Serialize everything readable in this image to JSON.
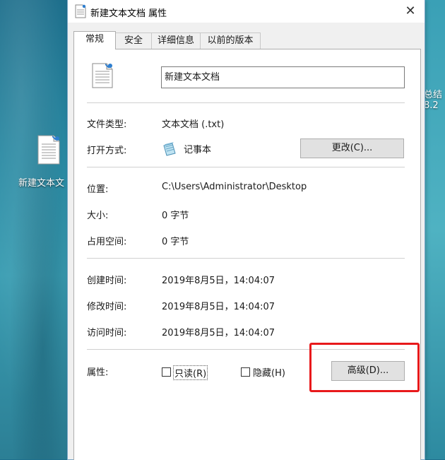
{
  "desktop": {
    "icon_label": "新建文本文",
    "edge_text_1": "总结",
    "edge_text_2": "8.2"
  },
  "window": {
    "title": "新建文本文档 属性",
    "close_glyph": "✕"
  },
  "tabs": [
    {
      "label": "常规",
      "active": true
    },
    {
      "label": "安全",
      "active": false
    },
    {
      "label": "详细信息",
      "active": false
    },
    {
      "label": "以前的版本",
      "active": false
    }
  ],
  "general": {
    "file_name": "新建文本文档",
    "file_type_label": "文件类型:",
    "file_type_value": "文本文档 (.txt)",
    "open_with_label": "打开方式:",
    "open_with_value": "记事本",
    "change_button": "更改(C)...",
    "location_label": "位置:",
    "location_value": "C:\\Users\\Administrator\\Desktop",
    "size_label": "大小:",
    "size_value": "0 字节",
    "disk_size_label": "占用空间:",
    "disk_size_value": "0 字节",
    "created_label": "创建时间:",
    "created_value": "2019年8月5日，14:04:07",
    "modified_label": "修改时间:",
    "modified_value": "2019年8月5日，14:04:07",
    "accessed_label": "访问时间:",
    "accessed_value": "2019年8月5日，14:04:07",
    "attributes_label": "属性:",
    "readonly_label": "只读(R)",
    "readonly_checked": false,
    "hidden_label": "隐藏(H)",
    "hidden_checked": false,
    "advanced_button": "高级(D)..."
  },
  "colors": {
    "highlight_border": "#e8191b",
    "dialog_bg": "#f0f0f0",
    "button_bg": "#e1e1e1"
  }
}
